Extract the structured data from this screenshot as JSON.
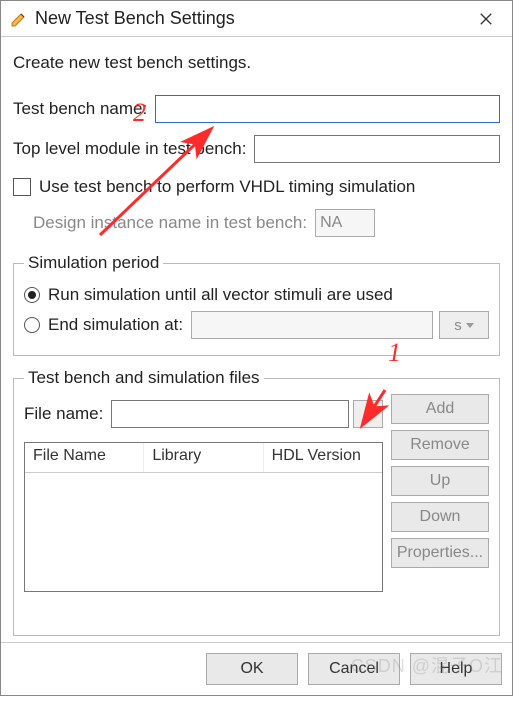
{
  "titlebar": {
    "title": "New Test Bench Settings"
  },
  "description": "Create new test bench settings.",
  "fields": {
    "test_bench_name_label": "Test bench name:",
    "test_bench_name_value": "",
    "top_module_label": "Top level module in test bench:",
    "top_module_value": "",
    "vhdl_timing_label": "Use test bench to perform VHDL timing simulation",
    "design_instance_label": "Design instance name in test bench:",
    "design_instance_value": "NA"
  },
  "sim_period": {
    "legend": "Simulation period",
    "run_until_label": "Run simulation until all vector stimuli are used",
    "end_at_label": "End simulation at:",
    "end_at_value": "",
    "unit": "s"
  },
  "files": {
    "legend": "Test bench and simulation files",
    "file_name_label": "File name:",
    "file_name_value": "",
    "browse_label": "...",
    "columns": {
      "c1": "File Name",
      "c2": "Library",
      "c3": "HDL Version"
    },
    "buttons": {
      "add": "Add",
      "remove": "Remove",
      "up": "Up",
      "down": "Down",
      "properties": "Properties..."
    }
  },
  "footer": {
    "ok": "OK",
    "cancel": "Cancel",
    "help": "Help"
  },
  "annotations": {
    "a1": "1",
    "a2": "2"
  },
  "watermark": "CSDN @混子O江"
}
